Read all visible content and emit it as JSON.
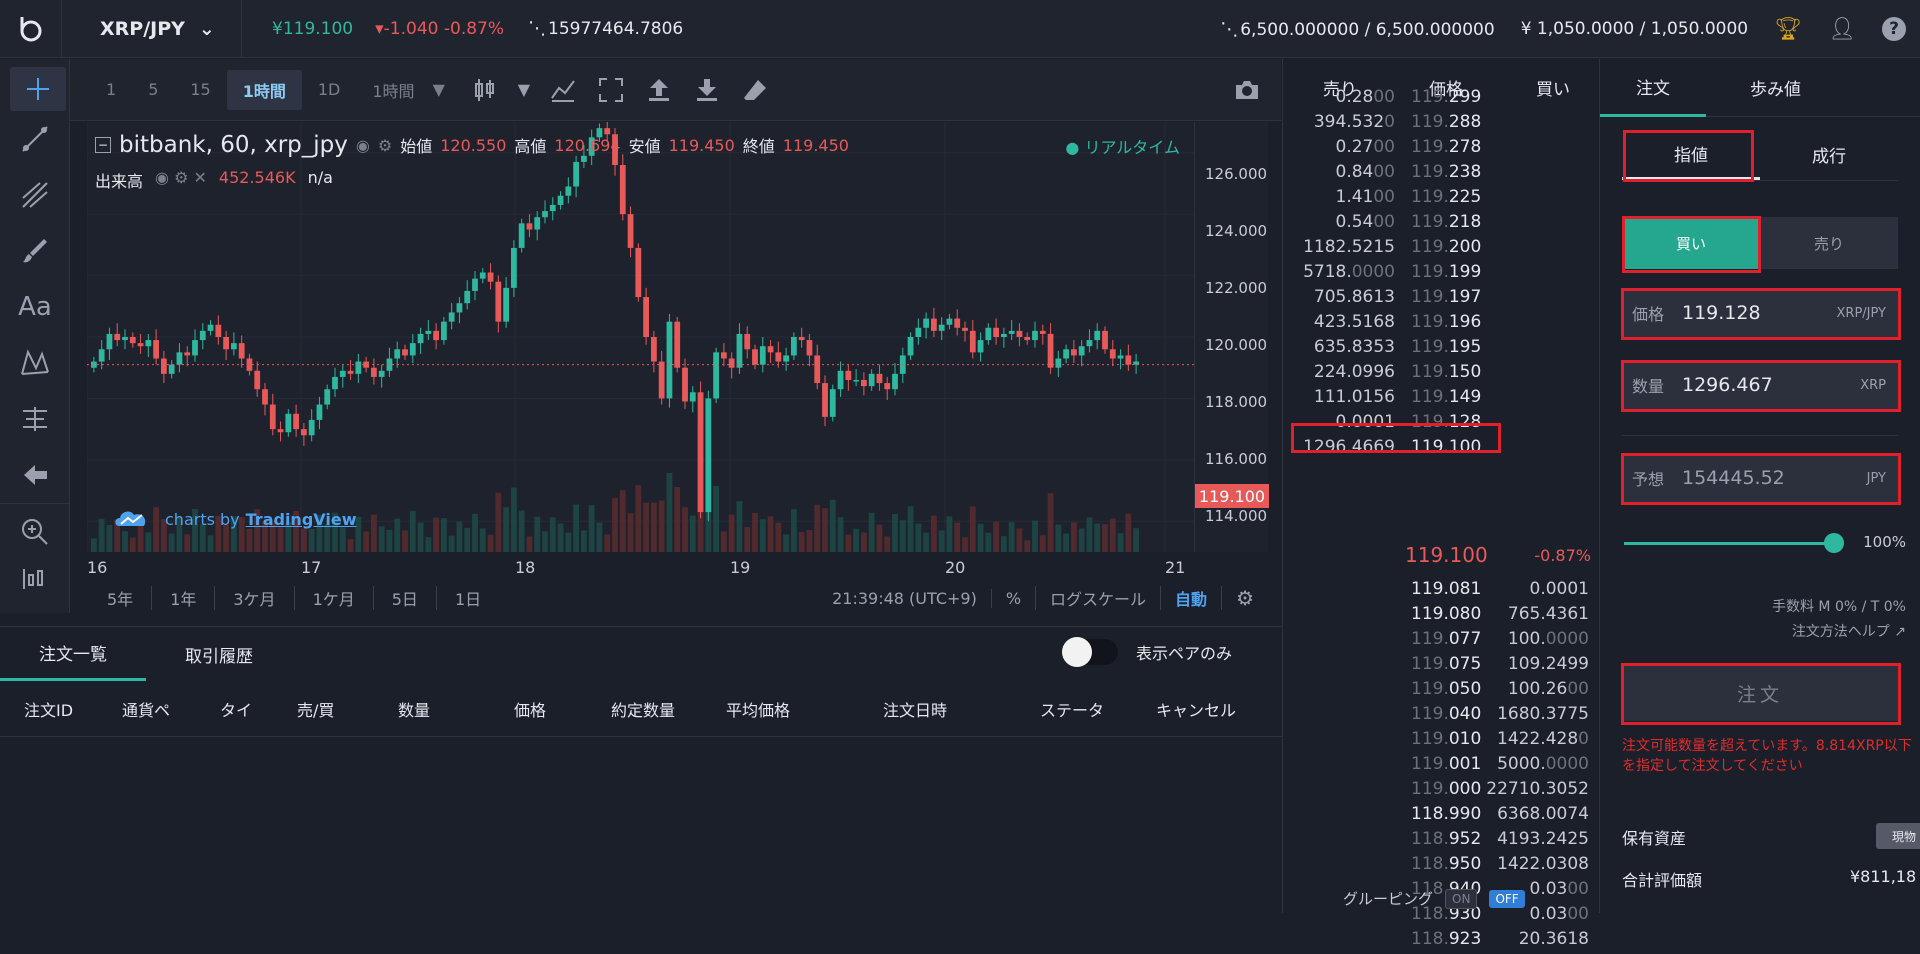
{
  "topbar": {
    "pair": "XRP/JPY",
    "last_price": "¥119.100",
    "change": "-1.040 -0.87%",
    "volume": "15977464.7806",
    "xrp_balance": "6,500.000000 / 6,500.000000",
    "jpy_balance": "¥ 1,050.0000 / 1,050.0000"
  },
  "chart_toolbar": {
    "timeframes": [
      "1",
      "5",
      "15",
      "1時間",
      "1D",
      "1時間"
    ]
  },
  "chart_info": {
    "symbol": "bitbank, 60, xrp_jpy",
    "open_label": "始値",
    "open": "120.550",
    "high_label": "高値",
    "high": "120.694",
    "low_label": "安値",
    "low": "119.450",
    "close_label": "終値",
    "close": "119.450",
    "volume_label": "出来高",
    "volume_value": "452.546K",
    "volume_na": "n/a",
    "realtime": "● リアルタイム",
    "brand_prefix": "charts by",
    "brand_link": "TradingView"
  },
  "chart_data": {
    "type": "candlestick",
    "ylim": [
      113,
      127
    ],
    "y_ticks": [
      "126.000",
      "124.000",
      "122.000",
      "120.000",
      "118.000",
      "116.000",
      "114.000"
    ],
    "x_ticks": [
      "16",
      "17",
      "18",
      "19",
      "20",
      "21"
    ],
    "last_price_label": "119.100",
    "close_series": [
      119.2,
      119.6,
      120.1,
      119.9,
      120.0,
      119.8,
      119.7,
      119.9,
      119.3,
      118.8,
      119.1,
      119.5,
      119.4,
      119.9,
      120.2,
      120.4,
      120.0,
      119.6,
      119.8,
      119.3,
      118.9,
      118.3,
      117.8,
      117.0,
      116.9,
      117.5,
      117.0,
      116.8,
      117.3,
      117.8,
      118.3,
      118.7,
      118.9,
      118.8,
      119.2,
      119.0,
      118.7,
      118.9,
      119.3,
      119.6,
      119.4,
      119.8,
      120.1,
      120.2,
      119.9,
      120.5,
      120.8,
      121.1,
      121.5,
      121.9,
      122.1,
      121.8,
      120.5,
      121.6,
      122.9,
      123.7,
      123.5,
      123.9,
      124.1,
      124.3,
      124.6,
      124.9,
      125.7,
      125.9,
      126.5,
      126.8,
      126.6,
      125.6,
      124.0,
      122.9,
      121.3,
      120.0,
      119.2,
      118.0,
      120.5,
      119.0,
      117.9,
      118.2,
      114.3,
      118.0,
      119.5,
      119.3,
      119.0,
      120.1,
      119.6,
      119.1,
      119.7,
      119.5,
      119.2,
      119.4,
      120.0,
      119.9,
      119.4,
      118.5,
      117.4,
      118.3,
      118.9,
      118.6,
      118.6,
      118.4,
      118.8,
      118.5,
      118.3,
      118.8,
      119.4,
      120.0,
      120.3,
      120.6,
      120.2,
      120.4,
      120.6,
      120.3,
      120.2,
      119.5,
      119.9,
      120.3,
      120.0,
      120.1,
      120.2,
      120.0,
      119.9,
      120.2,
      120.1,
      119.0,
      119.3,
      119.6,
      119.4,
      119.7,
      119.9,
      120.2,
      119.6,
      119.3,
      119.4,
      119.1,
      119.2
    ]
  },
  "range_bar": {
    "ranges": [
      "5年",
      "1年",
      "3ケ月",
      "1ケ月",
      "5日",
      "1日"
    ],
    "time": "21:39:48 (UTC+9)",
    "percent": "%",
    "log": "ログスケール",
    "auto": "自動"
  },
  "orders_panel": {
    "tabs": [
      "注文一覧",
      "取引履歴"
    ],
    "pair_only": "表示ペアのみ",
    "columns": [
      "注文ID",
      "通貨ペ",
      "タイ",
      "売/買",
      "数量",
      "価格",
      "約定数量",
      "平均価格",
      "注文日時",
      "ステータ",
      "キャンセル"
    ]
  },
  "orderbook": {
    "headers": [
      "売り",
      "価格",
      "買い"
    ],
    "asks": [
      {
        "amt_hi": "0.28",
        "amt_tr": "00",
        "p_tr": "119.",
        "p_hi": "299"
      },
      {
        "amt_hi": "394.532",
        "amt_tr": "0",
        "p_tr": "119.",
        "p_hi": "288"
      },
      {
        "amt_hi": "0.27",
        "amt_tr": "00",
        "p_tr": "119.",
        "p_hi": "278"
      },
      {
        "amt_hi": "0.84",
        "amt_tr": "00",
        "p_tr": "119.",
        "p_hi": "238"
      },
      {
        "amt_hi": "1.41",
        "amt_tr": "00",
        "p_tr": "119.",
        "p_hi": "225"
      },
      {
        "amt_hi": "0.54",
        "amt_tr": "00",
        "p_tr": "119.",
        "p_hi": "218"
      },
      {
        "amt_hi": "1182.5215",
        "amt_tr": "",
        "p_tr": "119.",
        "p_hi": "200"
      },
      {
        "amt_hi": "5718.",
        "amt_tr": "0000",
        "p_tr": "119.",
        "p_hi": "199"
      },
      {
        "amt_hi": "705.8613",
        "amt_tr": "",
        "p_tr": "119.",
        "p_hi": "197"
      },
      {
        "amt_hi": "423.5168",
        "amt_tr": "",
        "p_tr": "119.",
        "p_hi": "196"
      },
      {
        "amt_hi": "635.8353",
        "amt_tr": "",
        "p_tr": "119.",
        "p_hi": "195"
      },
      {
        "amt_hi": "224.0996",
        "amt_tr": "",
        "p_tr": "119.",
        "p_hi": "150"
      },
      {
        "amt_hi": "111.0156",
        "amt_tr": "",
        "p_tr": "119.",
        "p_hi": "149"
      },
      {
        "amt_hi": "0.0001",
        "amt_tr": "",
        "p_tr": "119.",
        "p_hi": "128"
      },
      {
        "amt_hi": "1296.4669",
        "amt_tr": "",
        "p_tr": "",
        "p_hi": "119.100"
      }
    ],
    "mid_price": "119.100",
    "mid_change": "-0.87%",
    "bids": [
      {
        "p_tr": "",
        "p_hi": "119.081",
        "amt_hi": "0.0001",
        "amt_tr": ""
      },
      {
        "p_tr": "",
        "p_hi": "119.080",
        "amt_hi": "765.4361",
        "amt_tr": ""
      },
      {
        "p_tr": "119.",
        "p_hi": "077",
        "amt_hi": "100.",
        "amt_tr": "0000"
      },
      {
        "p_tr": "119.",
        "p_hi": "075",
        "amt_hi": "109.2499",
        "amt_tr": ""
      },
      {
        "p_tr": "119.",
        "p_hi": "050",
        "amt_hi": "100.26",
        "amt_tr": "00"
      },
      {
        "p_tr": "119.",
        "p_hi": "040",
        "amt_hi": "1680.3775",
        "amt_tr": ""
      },
      {
        "p_tr": "119.",
        "p_hi": "010",
        "amt_hi": "1422.428",
        "amt_tr": "0"
      },
      {
        "p_tr": "119.",
        "p_hi": "001",
        "amt_hi": "5000.",
        "amt_tr": "0000"
      },
      {
        "p_tr": "119.",
        "p_hi": "000",
        "amt_hi": "22710.3052",
        "amt_tr": ""
      },
      {
        "p_tr": "",
        "p_hi": "118.990",
        "amt_hi": "6368.0074",
        "amt_tr": ""
      },
      {
        "p_tr": "118.",
        "p_hi": "952",
        "amt_hi": "4193.2425",
        "amt_tr": ""
      },
      {
        "p_tr": "118.",
        "p_hi": "950",
        "amt_hi": "1422.0308",
        "amt_tr": ""
      },
      {
        "p_tr": "118.",
        "p_hi": "940",
        "amt_hi": "0.03",
        "amt_tr": "00"
      },
      {
        "p_tr": "118.",
        "p_hi": "930",
        "amt_hi": "0.03",
        "amt_tr": "00"
      },
      {
        "p_tr": "118.",
        "p_hi": "923",
        "amt_hi": "20.3618",
        "amt_tr": ""
      }
    ],
    "grouping_label": "グルーピング",
    "on": "ON",
    "off": "OFF"
  },
  "order_form": {
    "tabs": [
      "注文",
      "歩み値"
    ],
    "type_tabs": [
      "指値",
      "成行"
    ],
    "sides": [
      "買い",
      "売り"
    ],
    "price_label": "価格",
    "price": "119.128",
    "price_unit": "XRP/JPY",
    "qty_label": "数量",
    "qty": "1296.467",
    "qty_unit": "XRP",
    "est_label": "予想",
    "est": "154445.52",
    "est_unit": "JPY",
    "slider_pct": "100%",
    "fee": "手数料 M 0% / T 0%",
    "help": "注文方法ヘルプ",
    "submit": "注文",
    "error": "注文可能数量を超えています。8.814XRP以下を指定して注文してください",
    "assets_label": "保有資産",
    "spot": "現物",
    "total_label": "合計評価額",
    "total_value": "¥811,18"
  },
  "colors": {
    "up": "#2eb8a0",
    "down": "#e85a5a",
    "accent": "#4ea3f0",
    "highlight": "#e0202a"
  }
}
